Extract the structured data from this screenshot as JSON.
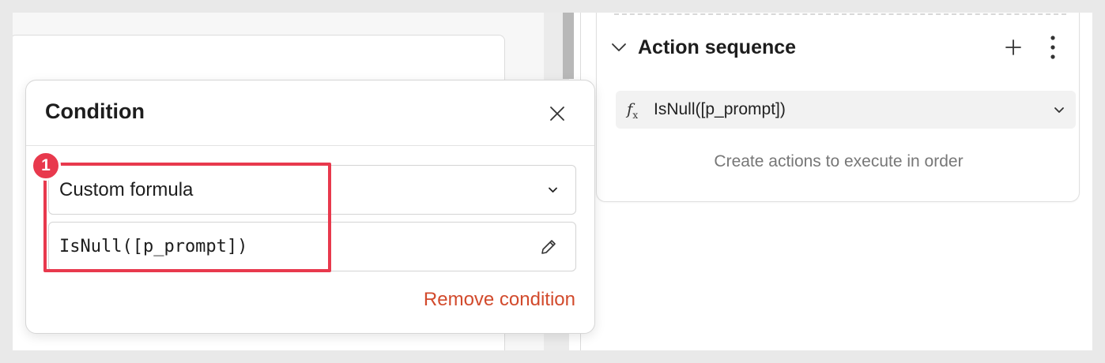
{
  "action_sequence": {
    "title": "Action sequence",
    "formula": "IsNull([p_prompt])",
    "formula_icon": "fx-icon",
    "empty_hint": "Create actions to execute in order"
  },
  "condition_popover": {
    "title": "Condition",
    "condition_type": "Custom formula",
    "formula_value": "IsNull([p_prompt])",
    "remove_label": "Remove condition"
  },
  "callout": {
    "number": "1",
    "color": "#e8394d"
  },
  "colors": {
    "accent_remove": "#d24a2c",
    "highlight": "#e8394d"
  }
}
